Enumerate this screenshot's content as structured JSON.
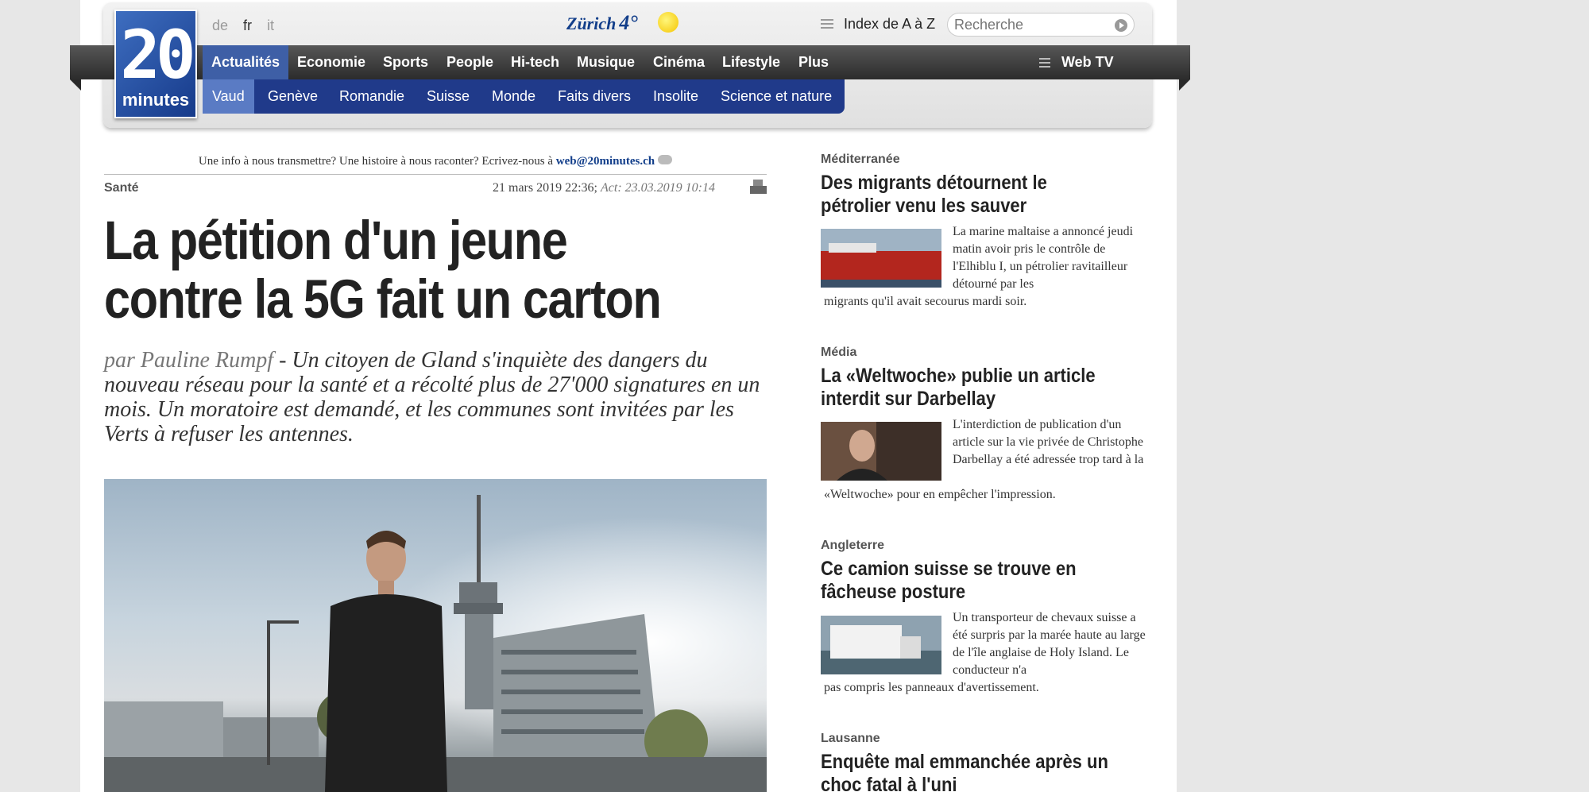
{
  "header": {
    "logo": {
      "number": "20",
      "word": "minutes"
    },
    "languages": [
      "de",
      "fr",
      "it"
    ],
    "weather": {
      "city": "Zürich",
      "temp": "4°"
    },
    "index_link": "Index de A à Z",
    "search_placeholder": "Recherche"
  },
  "main_nav": {
    "items": [
      "Actualités",
      "Economie",
      "Sports",
      "People",
      "Hi-tech",
      "Musique",
      "Cinéma",
      "Lifestyle",
      "Plus"
    ],
    "webtv": "Web TV"
  },
  "sub_nav": {
    "items": [
      "Vaud",
      "Genève",
      "Romandie",
      "Suisse",
      "Monde",
      "Faits divers",
      "Insolite",
      "Science et nature"
    ]
  },
  "article": {
    "tip_text": "Une info à nous transmettre? Une histoire à nous raconter? Ecrivez-nous à",
    "tip_email": "web@20minutes.ch",
    "category": "Santé",
    "date": "21 mars 2019 22:36;",
    "updated": "Act: 23.03.2019 10:14",
    "headline": "La pétition d'un jeune contre la 5G fait un carton",
    "author": "par Pauline Rumpf",
    "lead": " - Un citoyen de Gland s'inquiète des dangers du nouveau réseau pour la santé et a récolté plus de 27'000 signatures en un mois. Un moratoire est demandé, et les communes sont invitées par les Verts à refuser les antennes."
  },
  "sidebar": {
    "items": [
      {
        "category": "Méditerranée",
        "title": "Des migrants détournent le pétrolier venu les sauver",
        "text": "La marine maltaise a annoncé jeudi matin avoir pris le contrôle de l'Elhiblu I, un pétrolier ravitailleur détourné par les",
        "text_end": "migrants qu'il avait secourus mardi soir."
      },
      {
        "category": "Média",
        "title": "La «Weltwoche» publie un article interdit sur Darbellay",
        "text": "L'interdiction de publication d'un article sur la vie privée de Christophe Darbellay a été adressée trop tard à la",
        "text_end": "«Weltwoche» pour en empêcher l'impression."
      },
      {
        "category": "Angleterre",
        "title": "Ce camion suisse se trouve en fâcheuse posture",
        "text": "Un transporteur de chevaux suisse a été surpris par la marée haute au large de l'île anglaise de Holy Island. Le conducteur n'a",
        "text_end": "pas compris les panneaux d'avertissement."
      },
      {
        "category": "Lausanne",
        "title": "Enquête mal emmanchée après un choc fatal à l'uni"
      }
    ]
  }
}
